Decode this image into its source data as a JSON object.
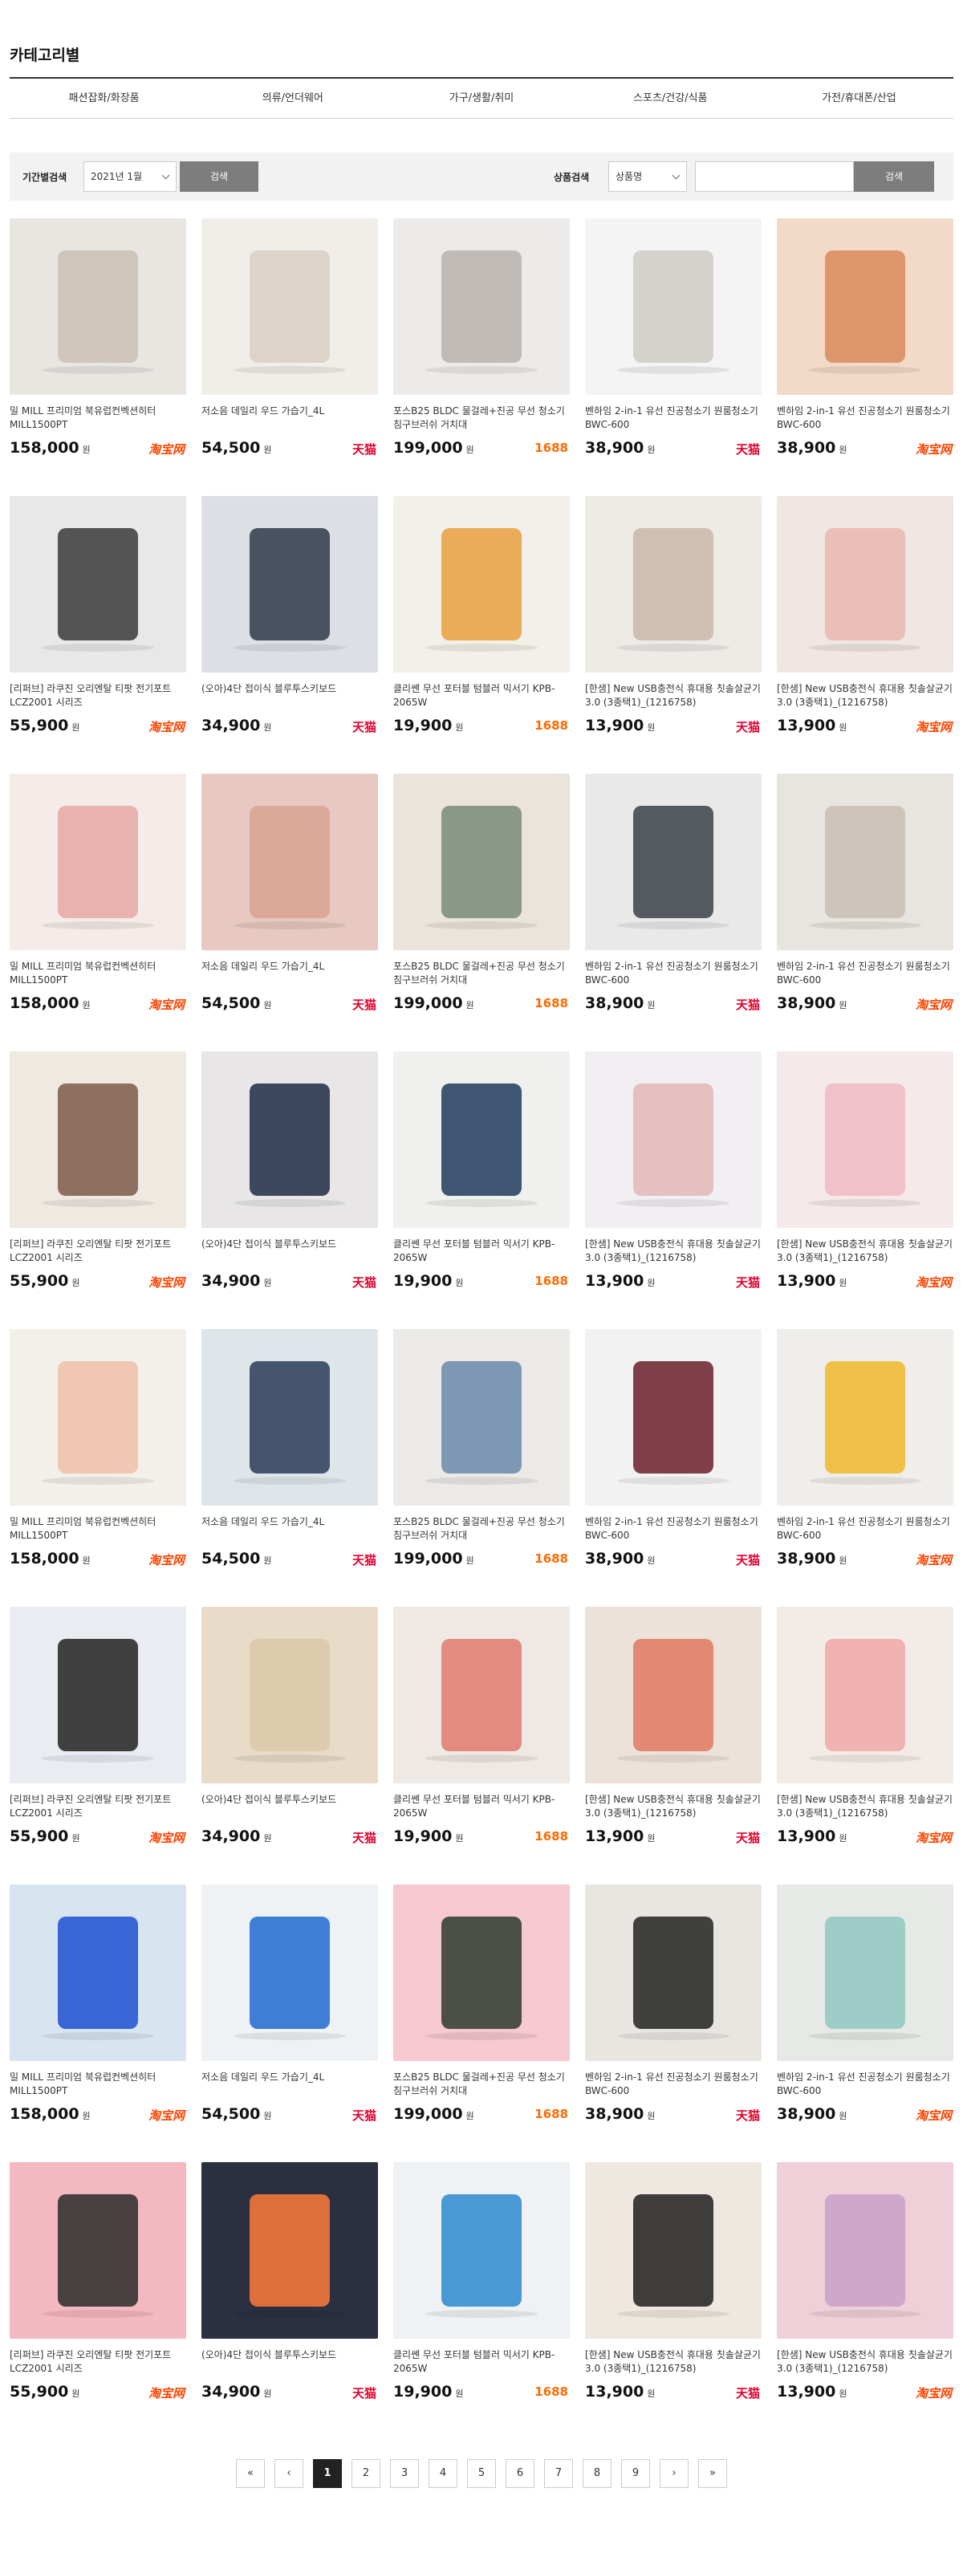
{
  "category": {
    "title": "카테고리별",
    "items": [
      "패션잡화/화장품",
      "의류/언더웨어",
      "가구/생활/취미",
      "스포츠/건강/식품",
      "가전/휴대폰/산업"
    ]
  },
  "filter": {
    "period_label": "기간별검색",
    "period_value": "2021년 1월",
    "period_button": "검색",
    "product_label": "상품검색",
    "product_select": "상품명",
    "search_input_value": "",
    "search_button": "검색"
  },
  "markets": {
    "taobao": "淘宝网",
    "tmall": "天猫",
    "1688": "1688"
  },
  "currency": "원",
  "products": [
    {
      "name": "밀 MILL 프리미엄 북유럽컨벡션히터 MILL1500PT",
      "price": "158,000",
      "market": "taobao"
    },
    {
      "name": "저소음 데일리 우드 가습기_4L",
      "price": "54,500",
      "market": "tmall"
    },
    {
      "name": "포스B25 BLDC 물걸레+진공 무선 청소기 침구브러쉬 거치대",
      "price": "199,000",
      "market": "1688"
    },
    {
      "name": "벤하임 2-in-1 유선 진공청소기 원룸청소기 BWC-600",
      "price": "38,900",
      "market": "tmall"
    },
    {
      "name": "벤하임 2-in-1 유선 진공청소기 원룸청소기 BWC-600",
      "price": "38,900",
      "market": "taobao"
    },
    {
      "name": "[리퍼브] 라쿠진 오리엔탈 티팟 전기포트 LCZ2001 시리즈",
      "price": "55,900",
      "market": "taobao"
    },
    {
      "name": "(오아)4단 접이식 블루투스키보드",
      "price": "34,900",
      "market": "tmall"
    },
    {
      "name": "클리쎈 무선 포터블 텀블러 믹서기 KPB-2065W",
      "price": "19,900",
      "market": "1688"
    },
    {
      "name": "[한샘] New USB충전식 휴대용 칫솔살균기3.0 (3종택1)_(1216758)",
      "price": "13,900",
      "market": "tmall"
    },
    {
      "name": "[한샘] New USB충전식 휴대용 칫솔살균기3.0 (3종택1)_(1216758)",
      "price": "13,900",
      "market": "taobao"
    },
    {
      "name": "밀 MILL 프리미엄 북유럽컨벡션히터 MILL1500PT",
      "price": "158,000",
      "market": "taobao"
    },
    {
      "name": "저소음 데일리 우드 가습기_4L",
      "price": "54,500",
      "market": "tmall"
    },
    {
      "name": "포스B25 BLDC 물걸레+진공 무선 청소기 침구브러쉬 거치대",
      "price": "199,000",
      "market": "1688"
    },
    {
      "name": "벤하임 2-in-1 유선 진공청소기 원룸청소기 BWC-600",
      "price": "38,900",
      "market": "tmall"
    },
    {
      "name": "벤하임 2-in-1 유선 진공청소기 원룸청소기 BWC-600",
      "price": "38,900",
      "market": "taobao"
    },
    {
      "name": "[리퍼브] 라쿠진 오리엔탈 티팟 전기포트 LCZ2001 시리즈",
      "price": "55,900",
      "market": "taobao"
    },
    {
      "name": "(오아)4단 접이식 블루투스키보드",
      "price": "34,900",
      "market": "tmall"
    },
    {
      "name": "클리쎈 무선 포터블 텀블러 믹서기 KPB-2065W",
      "price": "19,900",
      "market": "1688"
    },
    {
      "name": "[한샘] New USB충전식 휴대용 칫솔살균기3.0 (3종택1)_(1216758)",
      "price": "13,900",
      "market": "tmall"
    },
    {
      "name": "[한샘] New USB충전식 휴대용 칫솔살균기3.0 (3종택1)_(1216758)",
      "price": "13,900",
      "market": "taobao"
    },
    {
      "name": "밀 MILL 프리미엄 북유럽컨벡션히터 MILL1500PT",
      "price": "158,000",
      "market": "taobao"
    },
    {
      "name": "저소음 데일리 우드 가습기_4L",
      "price": "54,500",
      "market": "tmall"
    },
    {
      "name": "포스B25 BLDC 물걸레+진공 무선 청소기 침구브러쉬 거치대",
      "price": "199,000",
      "market": "1688"
    },
    {
      "name": "벤하임 2-in-1 유선 진공청소기 원룸청소기 BWC-600",
      "price": "38,900",
      "market": "tmall"
    },
    {
      "name": "벤하임 2-in-1 유선 진공청소기 원룸청소기 BWC-600",
      "price": "38,900",
      "market": "taobao"
    },
    {
      "name": "[리퍼브] 라쿠진 오리엔탈 티팟 전기포트 LCZ2001 시리즈",
      "price": "55,900",
      "market": "taobao"
    },
    {
      "name": "(오아)4단 접이식 블루투스키보드",
      "price": "34,900",
      "market": "tmall"
    },
    {
      "name": "클리쎈 무선 포터블 텀블러 믹서기 KPB-2065W",
      "price": "19,900",
      "market": "1688"
    },
    {
      "name": "[한샘] New USB충전식 휴대용 칫솔살균기3.0 (3종택1)_(1216758)",
      "price": "13,900",
      "market": "tmall"
    },
    {
      "name": "[한샘] New USB충전식 휴대용 칫솔살균기3.0 (3종택1)_(1216758)",
      "price": "13,900",
      "market": "taobao"
    },
    {
      "name": "밀 MILL 프리미엄 북유럽컨벡션히터 MILL1500PT",
      "price": "158,000",
      "market": "taobao"
    },
    {
      "name": "저소음 데일리 우드 가습기_4L",
      "price": "54,500",
      "market": "tmall"
    },
    {
      "name": "포스B25 BLDC 물걸레+진공 무선 청소기 침구브러쉬 거치대",
      "price": "199,000",
      "market": "1688"
    },
    {
      "name": "벤하임 2-in-1 유선 진공청소기 원룸청소기 BWC-600",
      "price": "38,900",
      "market": "tmall"
    },
    {
      "name": "벤하임 2-in-1 유선 진공청소기 원룸청소기 BWC-600",
      "price": "38,900",
      "market": "taobao"
    },
    {
      "name": "[리퍼브] 라쿠진 오리엔탈 티팟 전기포트 LCZ2001 시리즈",
      "price": "55,900",
      "market": "taobao"
    },
    {
      "name": "(오아)4단 접이식 블루투스키보드",
      "price": "34,900",
      "market": "tmall"
    },
    {
      "name": "클리쎈 무선 포터블 텀블러 믹서기 KPB-2065W",
      "price": "19,900",
      "market": "1688"
    },
    {
      "name": "[한샘] New USB충전식 휴대용 칫솔살균기3.0 (3종택1)_(1216758)",
      "price": "13,900",
      "market": "tmall"
    },
    {
      "name": "[한샘] New USB충전식 휴대용 칫솔살균기3.0 (3종택1)_(1216758)",
      "price": "13,900",
      "market": "taobao"
    }
  ],
  "pagination": {
    "first": "«",
    "prev": "‹",
    "pages": [
      "1",
      "2",
      "3",
      "4",
      "5",
      "6",
      "7",
      "8",
      "9"
    ],
    "current": "1",
    "next": "›",
    "last": "»"
  }
}
